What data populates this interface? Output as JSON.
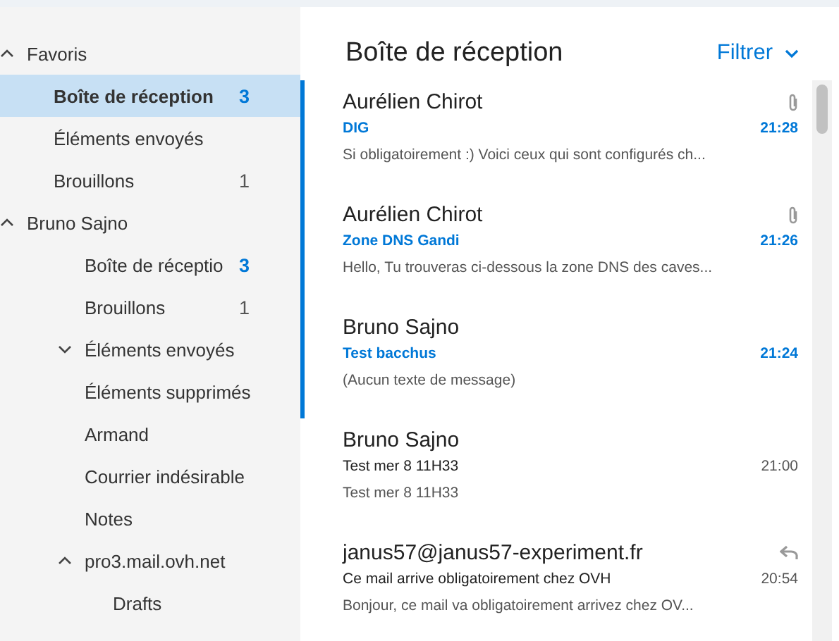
{
  "folders": [
    {
      "label": "Favoris",
      "kind": "favorites",
      "expanded": true,
      "children": [
        {
          "label": "Boîte de réception",
          "count": "3",
          "unread": true,
          "selected": true
        },
        {
          "label": "Éléments envoyés",
          "selected": false
        },
        {
          "label": "Brouillons",
          "count": "1",
          "unread": false,
          "selected": false
        }
      ]
    },
    {
      "label": "Bruno Sajno",
      "kind": "account",
      "expanded": true,
      "children": [
        {
          "label": "Boîte de réceptio",
          "count": "3",
          "unread": true,
          "selected": false
        },
        {
          "label": "Brouillons",
          "count": "1",
          "unread": false,
          "selected": false
        },
        {
          "label": "Éléments envoyés",
          "expanded": false,
          "selected": false
        },
        {
          "label": "Éléments supprimés",
          "selected": false
        },
        {
          "label": "Armand",
          "selected": false
        },
        {
          "label": "Courrier indésirable",
          "selected": false
        },
        {
          "label": "Notes",
          "selected": false
        },
        {
          "label": "pro3.mail.ovh.net",
          "expanded": true,
          "selected": false,
          "children": [
            {
              "label": "Drafts",
              "selected": false
            }
          ]
        }
      ]
    }
  ],
  "inbox": {
    "title": "Boîte de réception",
    "filter": "Filtrer"
  },
  "messages": [
    {
      "sender": "Aurélien Chirot",
      "subject": "DIG",
      "time": "21:28",
      "preview": "Si obligatoirement :) Voici ceux qui sont configurés ch...",
      "unread": true,
      "attachment": true
    },
    {
      "sender": "Aurélien Chirot",
      "subject": "Zone DNS Gandi",
      "time": "21:26",
      "preview": "Hello,  Tu trouveras ci-dessous la zone DNS des caves...",
      "unread": true,
      "attachment": true
    },
    {
      "sender": "Bruno Sajno",
      "subject": "Test bacchus",
      "time": "21:24",
      "preview": "(Aucun texte de message)",
      "unread": true
    },
    {
      "sender": "Bruno Sajno",
      "subject": "Test mer 8 11H33",
      "time": "21:00",
      "preview": "Test mer 8 11H33",
      "unread": false
    },
    {
      "sender": "janus57@janus57-experiment.fr",
      "subject": "Ce mail arrive obligatoirement chez OVH",
      "time": "20:54",
      "preview": "Bonjour,  ce mail va obligatoirement arrivez chez OV...",
      "unread": false,
      "replied": true
    }
  ]
}
